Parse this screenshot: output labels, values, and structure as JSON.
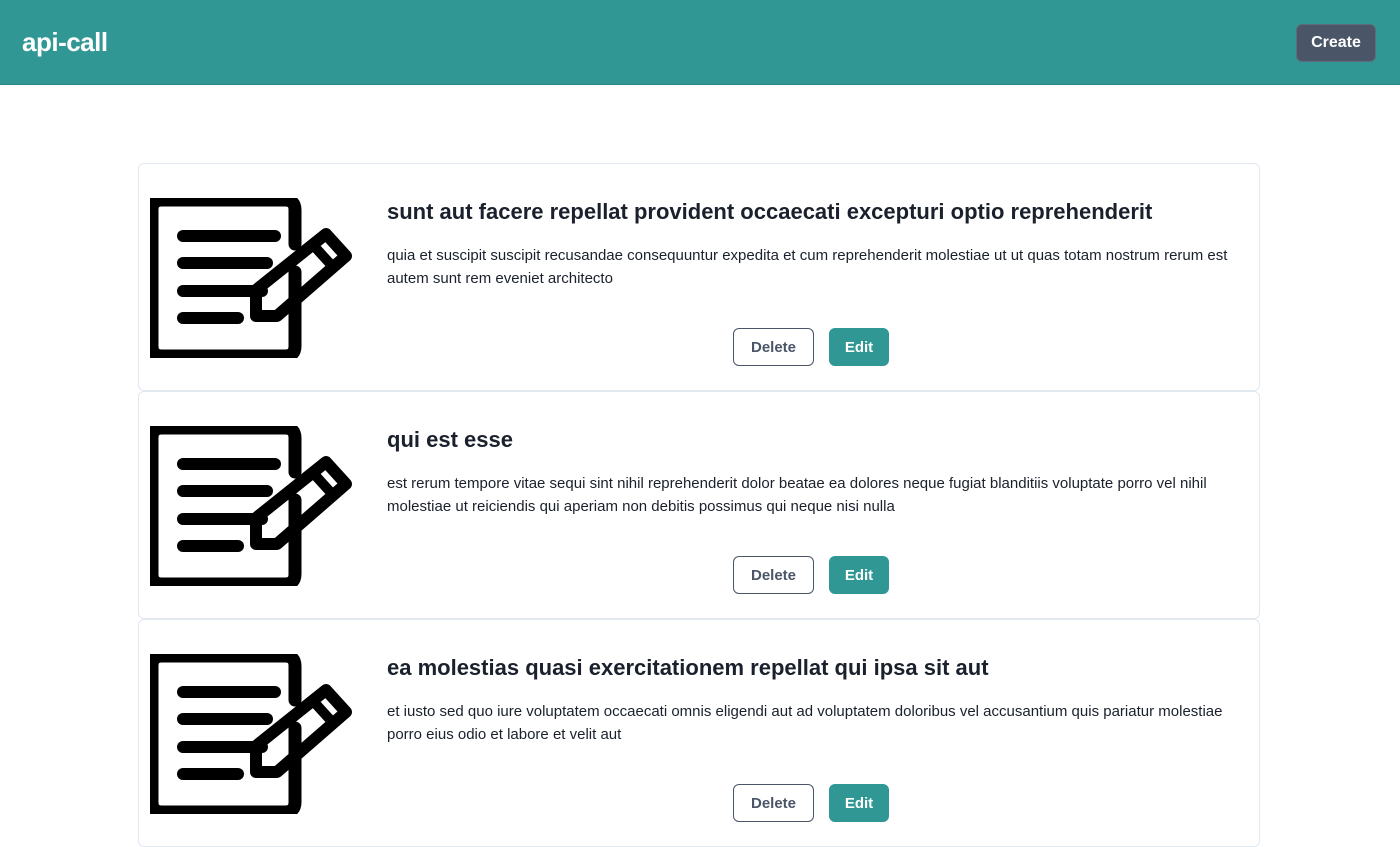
{
  "header": {
    "brand": "api-call",
    "create_label": "Create",
    "background_color": "#319795",
    "create_button_color": "#4a5568"
  },
  "posts": [
    {
      "title": "sunt aut facere repellat provident occaecati excepturi optio reprehenderit",
      "body": "quia et suscipit suscipit recusandae consequuntur expedita et cum reprehenderit molestiae ut ut quas totam nostrum rerum est autem sunt rem eveniet architecto",
      "icon": "note-edit-icon",
      "delete_label": "Delete",
      "edit_label": "Edit"
    },
    {
      "title": "qui est esse",
      "body": "est rerum tempore vitae sequi sint nihil reprehenderit dolor beatae ea dolores neque fugiat blanditiis voluptate porro vel nihil molestiae ut reiciendis qui aperiam non debitis possimus qui neque nisi nulla",
      "icon": "note-edit-icon",
      "delete_label": "Delete",
      "edit_label": "Edit"
    },
    {
      "title": "ea molestias quasi exercitationem repellat qui ipsa sit aut",
      "body": "et iusto sed quo iure voluptatem occaecati omnis eligendi aut ad voluptatem doloribus vel accusantium quis pariatur molestiae porro eius odio et labore et velit aut",
      "icon": "note-edit-icon",
      "delete_label": "Delete",
      "edit_label": "Edit"
    }
  ]
}
